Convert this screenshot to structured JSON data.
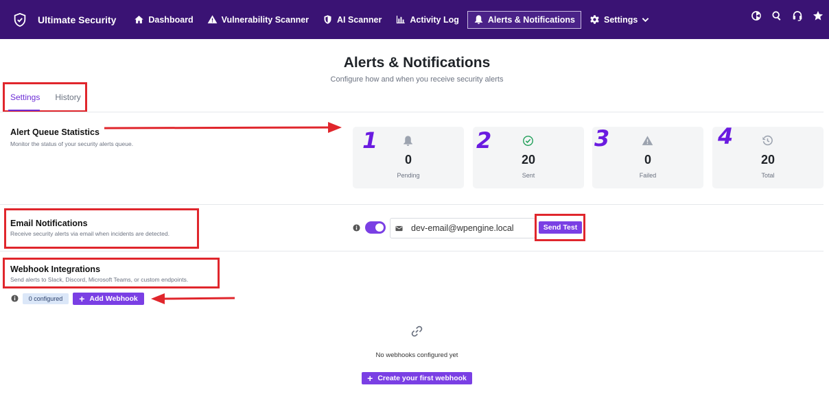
{
  "app": {
    "name": "Ultimate Security"
  },
  "nav": {
    "items": [
      {
        "label": "Dashboard",
        "icon": "home-icon"
      },
      {
        "label": "Vulnerability Scanner",
        "icon": "warning-icon"
      },
      {
        "label": "AI Scanner",
        "icon": "shield-icon"
      },
      {
        "label": "Activity Log",
        "icon": "bar-chart-icon"
      },
      {
        "label": "Alerts & Notifications",
        "icon": "bell-icon",
        "active": true
      },
      {
        "label": "Settings",
        "icon": "gear-icon"
      }
    ],
    "right_icons": [
      "theme-toggle-icon",
      "search-icon",
      "support-headset-icon",
      "star-icon"
    ]
  },
  "page": {
    "title": "Alerts & Notifications",
    "subtitle": "Configure how and when you receive security alerts"
  },
  "tabs": [
    {
      "label": "Settings",
      "active": true
    },
    {
      "label": "History",
      "active": false
    }
  ],
  "queue": {
    "title": "Alert Queue Statistics",
    "description": "Monitor the status of your security alerts queue.",
    "stats": [
      {
        "value": "0",
        "label": "Pending",
        "icon": "bell-icon",
        "annotation": "1"
      },
      {
        "value": "20",
        "label": "Sent",
        "icon": "check-circle-icon",
        "annotation": "2"
      },
      {
        "value": "0",
        "label": "Failed",
        "icon": "warning-icon",
        "annotation": "3"
      },
      {
        "value": "20",
        "label": "Total",
        "icon": "history-icon",
        "annotation": "4"
      }
    ]
  },
  "email": {
    "title": "Email Notifications",
    "description": "Receive security alerts via email when incidents are detected.",
    "enabled": true,
    "address": "dev-email@wpengine.local",
    "send_test_label": "Send Test"
  },
  "webhooks": {
    "title": "Webhook Integrations",
    "description": "Send alerts to Slack, Discord, Microsoft Teams, or custom endpoints.",
    "configured_badge": "0 configured",
    "add_label": "Add Webhook",
    "empty_text": "No webhooks configured yet",
    "create_label": "Create your first webhook"
  },
  "colors": {
    "topbar": "#3a1374",
    "accent": "#7a3fe4",
    "annotation_red": "#e0262c",
    "annotation_purple": "#6a1be0"
  }
}
